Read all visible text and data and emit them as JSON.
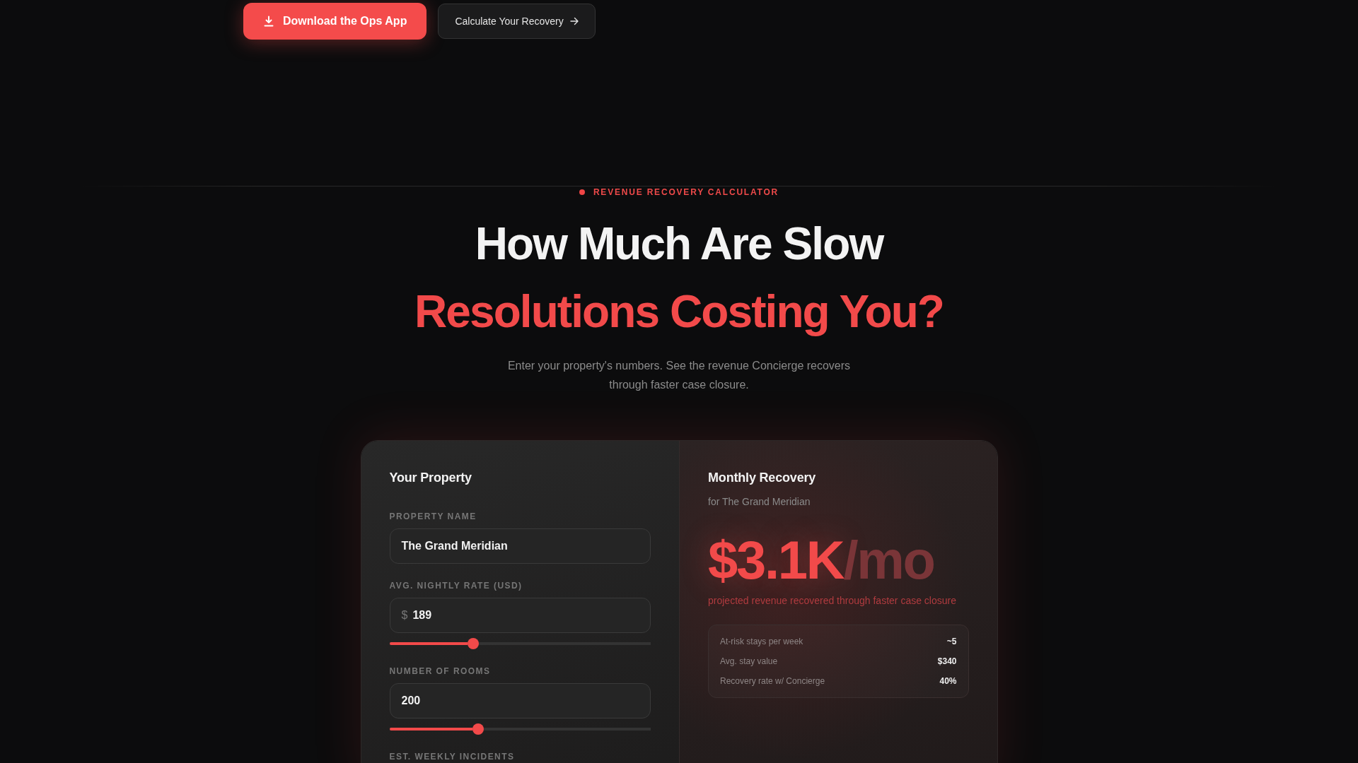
{
  "header_actions": [
    {
      "kind": "primary",
      "label": "Download the Ops App"
    },
    {
      "kind": "secondary",
      "label": "Calculate Your Recovery"
    }
  ],
  "calculator": {
    "eyebrow": "REVENUE RECOVERY CALCULATOR",
    "title_line_1": "How Much Are Slow",
    "title_line_2": "Resolutions Costing You?",
    "subtitle": "Enter your property's numbers. See the revenue Concierge recovers through faster case closure.",
    "inputs_panel": {
      "title": "Your Property",
      "fields": [
        {
          "label": "PROPERTY NAME",
          "value": "The Grand Meridian"
        },
        {
          "label": "AVG. NIGHTLY RATE (USD)",
          "prefix": "$",
          "value": "189",
          "level": 0.32
        },
        {
          "label": "NUMBER OF ROOMS",
          "value": "200",
          "level": 0.34
        },
        {
          "label": "EST. WEEKLY INCIDENTS"
        }
      ]
    },
    "results_panel": {
      "title": "Monthly Recovery",
      "subtitle": "for The Grand Meridian",
      "amount": "$3.1K",
      "unit": "/mo",
      "caption": "projected revenue recovered through faster case closure",
      "stats": [
        {
          "label": "At-risk stays per week",
          "value": "~5"
        },
        {
          "label": "Avg. stay value",
          "value": "$340"
        },
        {
          "label": "Recovery rate w/ Concierge",
          "value": "40%"
        }
      ]
    }
  }
}
